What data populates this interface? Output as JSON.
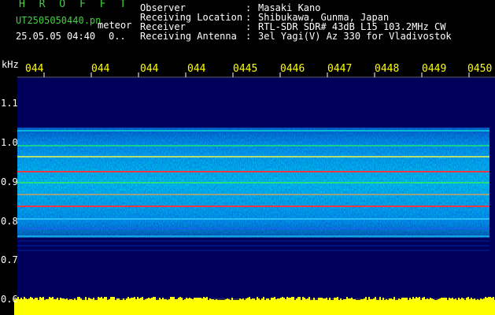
{
  "brand": "H R O F F T",
  "filename": "UT2505050440.pn",
  "mode": "meteor",
  "datetime": "25.05.05 04:40",
  "counter": "0..",
  "header": {
    "rows": [
      {
        "label": "Observer",
        "value": "Masaki Kano"
      },
      {
        "label": "Receiving Location",
        "value": "Shibukawa, Gunma, Japan"
      },
      {
        "label": "Receiver",
        "value": "RTL-SDR SDR# 43dB L15 103.2MHz CW"
      },
      {
        "label": "Receiving Antenna",
        "value": "3el Yagi(V) Az 330 for Vladivostok"
      }
    ],
    "separator": ":"
  },
  "frequency_unit": "kHz",
  "time_ticks": [
    "044",
    "044",
    "044",
    "044",
    "0445",
    "0446",
    "0447",
    "0448",
    "0449",
    "0450"
  ],
  "freq_labels": [
    "1.1",
    "1.0",
    "0.9",
    "0.8",
    "0.7",
    "0.6"
  ],
  "colors": {
    "background": "#000000",
    "spectrogram_base": "#000060",
    "power_bar": "#ffff00",
    "label_green": "#3fd23f",
    "text": "#ffffff"
  }
}
